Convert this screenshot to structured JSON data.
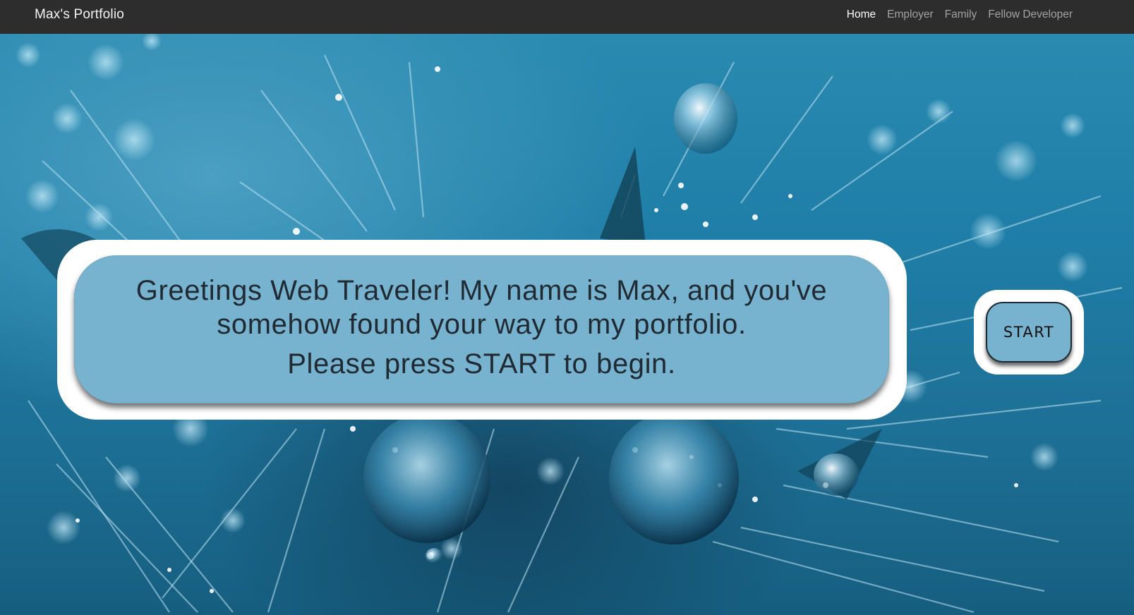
{
  "navbar": {
    "brand": "Max's Portfolio",
    "links": [
      {
        "label": "Home",
        "active": true
      },
      {
        "label": "Employer",
        "active": false
      },
      {
        "label": "Family",
        "active": false
      },
      {
        "label": "Fellow Developer",
        "active": false
      }
    ]
  },
  "hero": {
    "background_description_colors": {
      "base": "#1f7ea7",
      "dark": "#165e80",
      "light": "#4a9fc2"
    }
  },
  "greeting": {
    "line1": "Greetings Web Traveler! My name is Max, and you've somehow found your way to my portfolio.",
    "line2": "Please press START to begin."
  },
  "start_button": {
    "label": "START"
  },
  "colors": {
    "navbar_bg": "#2d2d2d",
    "card_fill": "#77b2cf",
    "card_border": "#ffffff",
    "text_dark": "#1f2a33"
  }
}
